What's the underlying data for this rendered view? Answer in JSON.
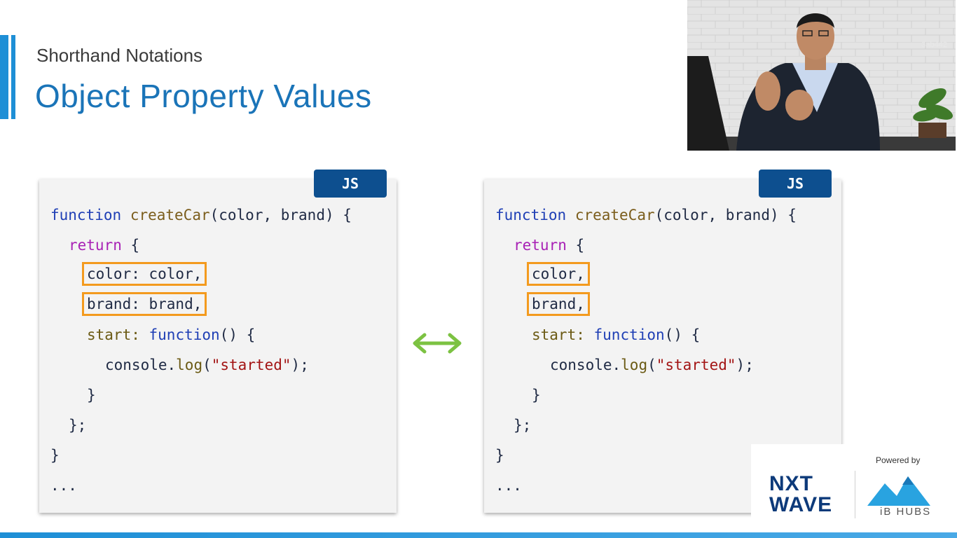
{
  "header": {
    "subtitle": "Shorthand Notations",
    "title": "Object Property Values"
  },
  "badge": "JS",
  "left_code": {
    "line1": {
      "kw": "function",
      "name": "createCar",
      "rest": "(color, brand) {"
    },
    "line2": {
      "kw": "return",
      "rest": " {"
    },
    "line3": {
      "hl": "color: color,"
    },
    "line4": {
      "hl": "brand: brand,"
    },
    "line5": {
      "prop": "start: ",
      "kw": "function",
      "rest": "() {"
    },
    "line6": {
      "obj": "console.",
      "method": "log",
      "open": "(",
      "str": "\"started\"",
      "close": ");"
    },
    "line7": "}",
    "line8": "};",
    "line9": "}",
    "line10": "..."
  },
  "right_code": {
    "line1": {
      "kw": "function",
      "name": "createCar",
      "rest": "(color, brand) {"
    },
    "line2": {
      "kw": "return",
      "rest": " {"
    },
    "line3": {
      "hl": "color,"
    },
    "line4": {
      "hl": "brand,"
    },
    "line5": {
      "prop": "start: ",
      "kw": "function",
      "rest": "() {"
    },
    "line6": {
      "obj": "console.",
      "method": "log",
      "open": "(",
      "str": "\"started\"",
      "close": ");"
    },
    "line7": "}",
    "line8": "};",
    "line9": "}",
    "line10": "..."
  },
  "webcam": {
    "id_text": "3ab442"
  },
  "logo": {
    "nxt": "NXT",
    "wave": "WAVE",
    "powered_by": "Powered by",
    "ibhubs": "iB HUBS"
  },
  "colors": {
    "title": "#1a74b8",
    "accent": "#1e8fd6",
    "badge": "#0d4f8f",
    "highlight": "#f39a1e",
    "arrow": "#7cc242"
  }
}
